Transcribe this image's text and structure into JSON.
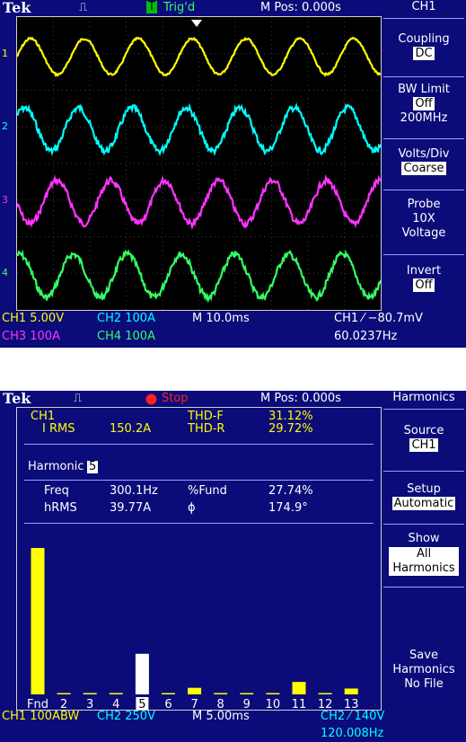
{
  "scope1": {
    "logo": "Tek",
    "acq_icon": "⎍",
    "trig_badge": "T",
    "trig_status": "Trig'd",
    "mpos": "M Pos: 0.000s",
    "menu": {
      "header": "CH1",
      "coupling_label": "Coupling",
      "coupling_value": "DC",
      "bw_label": "BW Limit",
      "bw_value": "Off",
      "bw_freq": "200MHz",
      "volts_label": "Volts/Div",
      "volts_value": "Coarse",
      "probe_label": "Probe",
      "probe_value": "10X",
      "probe_type": "Voltage",
      "invert_label": "Invert",
      "invert_value": "Off"
    },
    "status": {
      "ch1": "CH1  5.00V",
      "ch2": "CH2  100A",
      "ch3": "CH3  100A",
      "ch4": "CH4  100A",
      "timebase": "M 10.0ms",
      "trigger": "CH1 ⁄ −80.7mV",
      "freq": "60.0237Hz"
    },
    "markers": [
      "1",
      "2",
      "3",
      "4"
    ],
    "colors": {
      "ch1": "#ffff00",
      "ch2": "#00ffff",
      "ch3": "#ff33ff",
      "ch4": "#33ff66",
      "background": "#0b0b7a"
    }
  },
  "scope2": {
    "logo": "Tek",
    "acq_icon": "⎍",
    "stop_label": "Stop",
    "mpos": "M Pos: 0.000s",
    "menu": {
      "header": "Harmonics",
      "source_label": "Source",
      "source_value": "CH1",
      "setup_label": "Setup",
      "setup_value": "Automatic",
      "show_label": "Show",
      "show_value_1": "All",
      "show_value_2": "Harmonics",
      "save_label_1": "Save",
      "save_label_2": "Harmonics",
      "save_label_3": "No File"
    },
    "panel": {
      "ch": "CH1",
      "irms_label": "I RMS",
      "irms_value": "150.2A",
      "thdf_label": "THD-F",
      "thdf_value": "31.12%",
      "thdr_label": "THD-R",
      "thdr_value": "29.72%",
      "harmonic_label": "Harmonic",
      "harmonic_value": "5",
      "freq_label": "Freq",
      "freq_value": "300.1Hz",
      "fund_label": "%Fund",
      "fund_value": "27.74%",
      "hrms_label": "hRMS",
      "hrms_value": "39.77A",
      "phi_label": "ϕ",
      "phi_value": "174.9°"
    },
    "status": {
      "ch1": "CH1  100ABW",
      "ch2": "CH2  250V",
      "timebase": "M 5.00ms",
      "trigger": "CH2 ⁄ 140V",
      "freq": "120.008Hz"
    },
    "chart_data": {
      "type": "bar",
      "categories": [
        "Fnd",
        "2",
        "3",
        "4",
        "5",
        "6",
        "7",
        "8",
        "9",
        "10",
        "11",
        "12",
        "13"
      ],
      "values": [
        100,
        0.8,
        0.8,
        0.8,
        27.74,
        0.8,
        4.5,
        0.8,
        0.8,
        0.8,
        8.5,
        0.8,
        4.0
      ],
      "selected": "5",
      "bar_color": "#ffff00",
      "selected_color": "#ffffff",
      "ylim": [
        0,
        100
      ]
    }
  }
}
